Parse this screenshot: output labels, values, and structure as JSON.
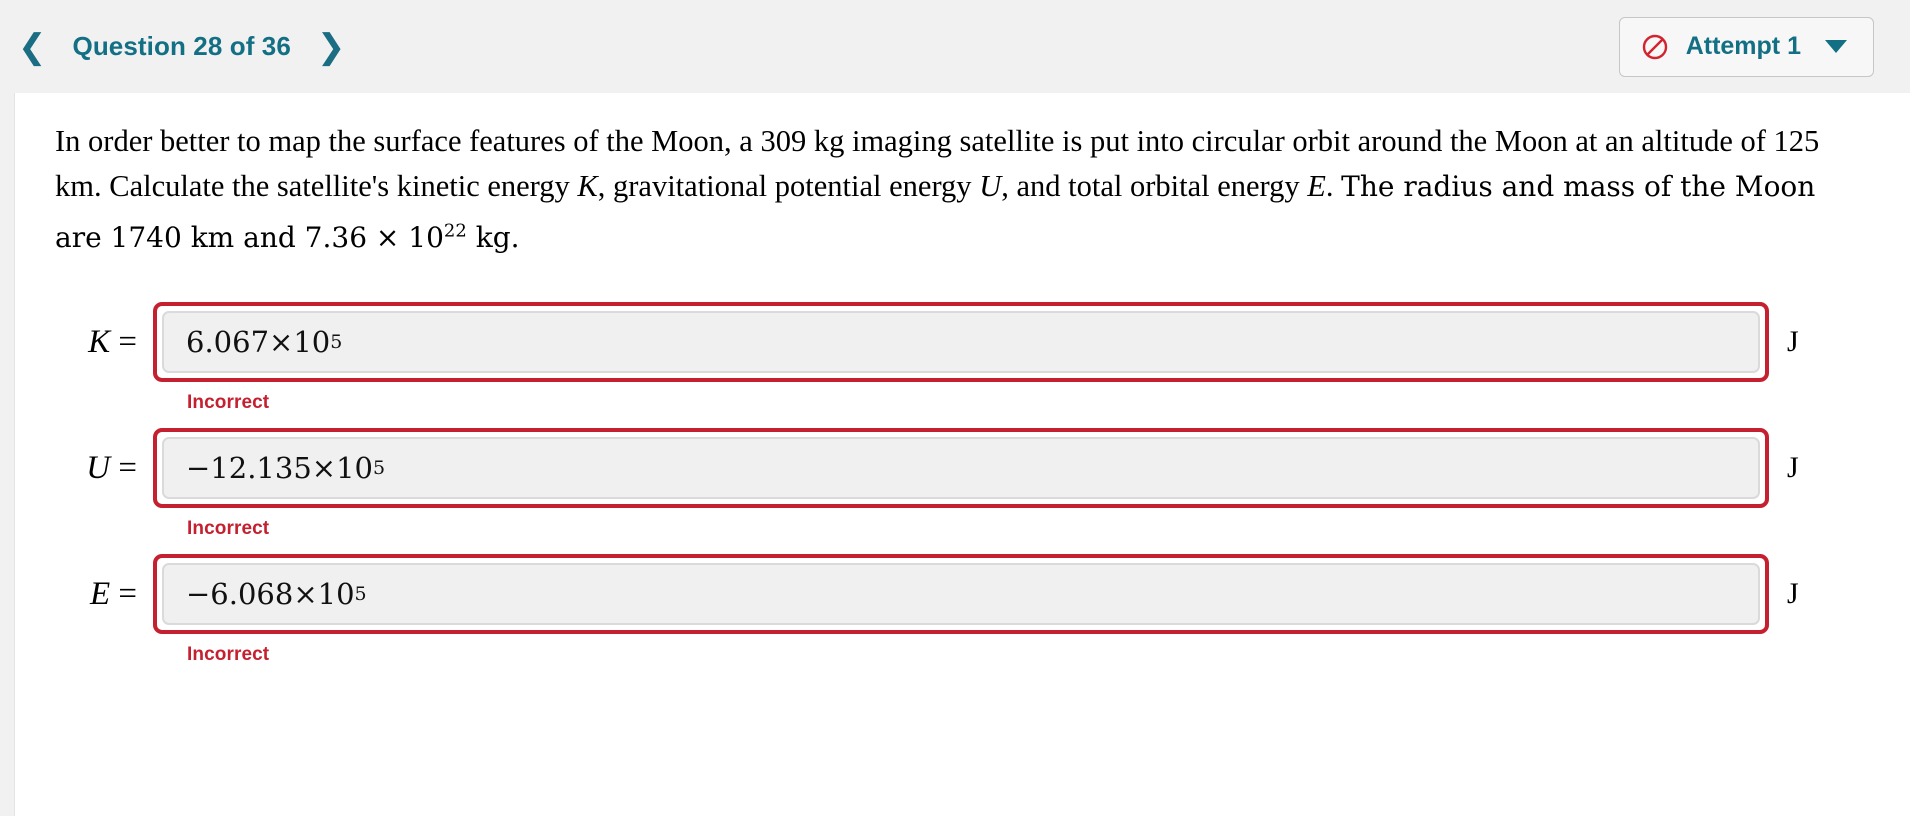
{
  "header": {
    "prev_icon": "chevron-left-icon",
    "next_icon": "chevron-right-icon",
    "prev_label": "‹",
    "next_label": "›",
    "question_title": "Question 28 of 36",
    "attempt": {
      "status_icon": "no-entry-icon",
      "label": "Attempt 1",
      "caret_icon": "chevron-down-icon"
    }
  },
  "question": {
    "line1_a": "In order better to map the surface features of the Moon, a 309 kg imaging satellite is put into circular orbit around the Moon at",
    "line2_a": "an altitude of 125 km. Calculate the satellite's kinetic energy ",
    "var_K": "K",
    "line2_b": ", gravitational potential energy ",
    "var_U": "U",
    "line2_c": ", and total orbital energy ",
    "var_E": "E",
    "line2_d": ".",
    "line3_a": "The radius and mass of the Moon are 1740 km and 7.36 × 10",
    "line3_exp": "22",
    "line3_b": " kg."
  },
  "answers": [
    {
      "symbol": "K",
      "equals": " =",
      "value_mantissa": "6.067 ",
      "value_times": "×10",
      "value_exponent": "5",
      "unit": "J",
      "feedback": "Incorrect"
    },
    {
      "symbol": "U",
      "equals": " =",
      "value_mantissa": "−12.135 ",
      "value_times": "×10",
      "value_exponent": "5",
      "unit": "J",
      "feedback": "Incorrect"
    },
    {
      "symbol": "E",
      "equals": " =",
      "value_mantissa": "−6.068 ",
      "value_times": "×10",
      "value_exponent": "5",
      "unit": "J",
      "feedback": "Incorrect"
    }
  ],
  "colors": {
    "accent_teal": "#136f84",
    "error_red": "#c4202f",
    "page_bg": "#f1f1f1",
    "field_bg": "#f0f0f0"
  }
}
